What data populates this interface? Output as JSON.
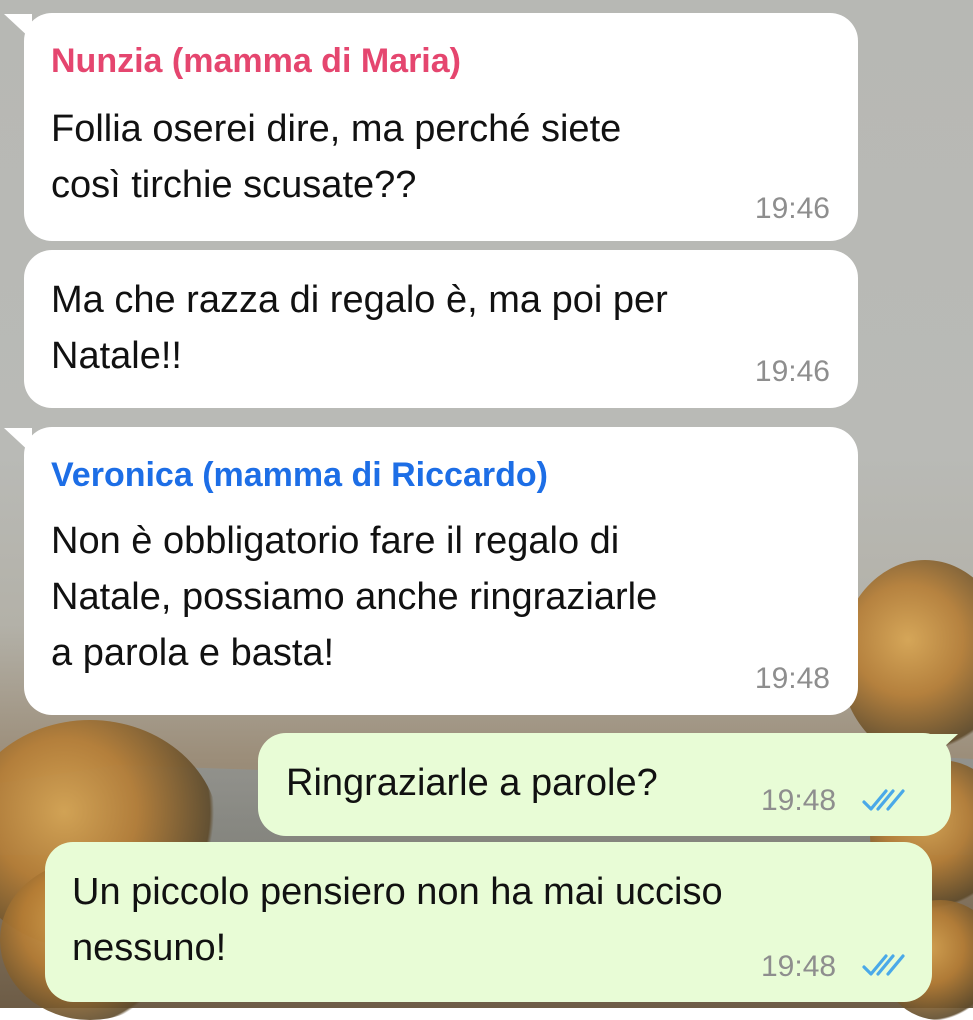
{
  "colors": {
    "incoming_bubble": "#ffffff",
    "outgoing_bubble": "#e8fcd6",
    "sender_1": "#e5466f",
    "sender_2": "#1d6ee6",
    "timestamp": "#8e8e8e",
    "read_ticks": "#4aa9e8"
  },
  "messages": [
    {
      "direction": "incoming",
      "sender": "Nunzia (mamma di Maria)",
      "text": "Follia oserei dire, ma perché siete\ncosì tirchie scusate??",
      "time": "19:46"
    },
    {
      "direction": "incoming",
      "text": "Ma che razza di regalo è, ma poi per\nNatale!!",
      "time": "19:46"
    },
    {
      "direction": "incoming",
      "sender": "Veronica (mamma di Riccardo)",
      "text": "Non è obbligatorio fare il regalo di\nNatale, possiamo anche ringraziarle\na parola e basta!",
      "time": "19:48"
    },
    {
      "direction": "outgoing",
      "text": "Ringraziarle a parole?",
      "time": "19:48",
      "status_icon": "double-check-read-icon"
    },
    {
      "direction": "outgoing",
      "text": "Un piccolo pensiero non ha mai ucciso\nnessuno!",
      "time": "19:48",
      "status_icon": "double-check-read-icon"
    }
  ]
}
